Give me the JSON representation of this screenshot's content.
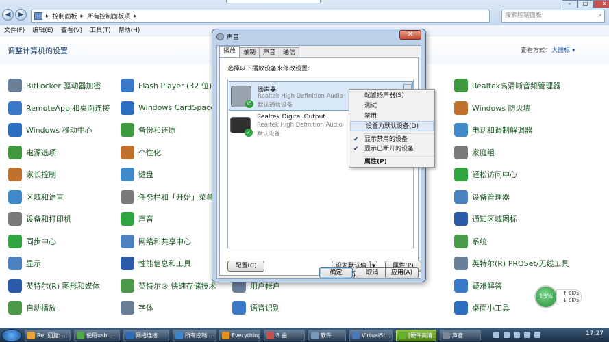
{
  "address": {
    "segments": [
      "控制面板",
      "所有控制面板项"
    ],
    "search_placeholder": "搜索控制面板"
  },
  "menu": [
    "文件(F)",
    "编辑(E)",
    "查看(V)",
    "工具(T)",
    "帮助(H)"
  ],
  "panel": {
    "title": "调整计算机的设置",
    "view_label": "查看方式：",
    "view_value": "大图标 ▾"
  },
  "col1": [
    "BitLocker 驱动器加密",
    "RemoteApp 和桌面连接",
    "Windows 移动中心",
    "电源选项",
    "家长控制",
    "区域和语言",
    "设备和打印机",
    "同步中心",
    "显示",
    "英特尔(R) 图形和媒体",
    "自动播放"
  ],
  "col2": [
    "Flash Player (32 位)",
    "Windows CardSpace",
    "备份和还原",
    "个性化",
    "键盘",
    "任务栏和「开始」菜单",
    "声音",
    "网络和共享中心",
    "性能信息和工具",
    "英特尔® 快速存储技术",
    "字体"
  ],
  "col3": [
    "用户帐户",
    "语音识别"
  ],
  "col4": [
    "Realtek高清晰音频管理器",
    "Windows 防火墙",
    "电话和调制解调器",
    "家庭组",
    "轻松访问中心",
    "设备管理器",
    "通知区域图标",
    "系统",
    "英特尔(R) PROSet/无线工具",
    "疑难解答",
    "桌面小工具"
  ],
  "dialog": {
    "title": "声音",
    "tabs": [
      "播放",
      "录制",
      "声音",
      "通信"
    ],
    "instruction": "选择以下播放设备来修改设置:",
    "devices": [
      {
        "name": "扬声器",
        "driver": "Realtek High Definition Audio",
        "status": "默认通信设备"
      },
      {
        "name": "Realtek Digital Output",
        "driver": "Realtek High Definition Audio",
        "status": "默认设备"
      }
    ],
    "configure": "配置(C)",
    "set_default": "设为默认值(S)",
    "properties": "属性(P)",
    "ok": "确定",
    "cancel": "取消",
    "apply": "应用(A)"
  },
  "context_menu": [
    "配置扬声器(S)",
    "测试",
    "禁用",
    "设置为默认设备(D)",
    "显示禁用的设备",
    "显示已断开的设备",
    "属性(P)"
  ],
  "network": {
    "percent": "13%",
    "up": "0K/s",
    "down": "0K/s"
  },
  "taskbar": [
    "Re: 回复: ...",
    "使用usb...",
    "网络连接",
    "所有控制...",
    "Everything",
    "B 曲",
    "软件",
    "VirtualSt...",
    "[硬件高清...",
    "声音"
  ],
  "clock": "17:27"
}
